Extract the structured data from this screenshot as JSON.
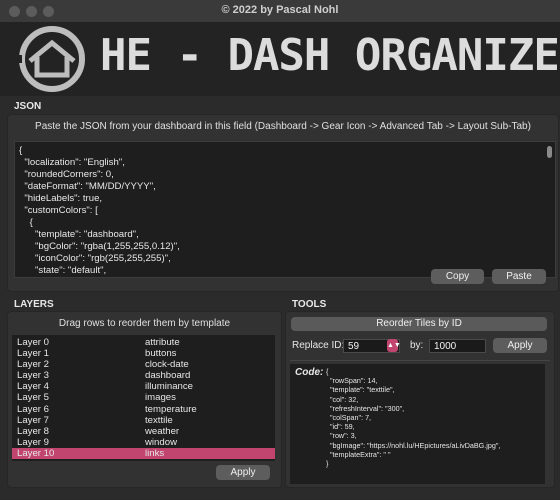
{
  "window": {
    "title": "© 2022 by Pascal Nohl"
  },
  "banner": {
    "title": "HE - DASH ORGANIZER",
    "logo_icon": "house-logo-icon"
  },
  "json_section": {
    "label": "JSON",
    "instructions": "Paste the JSON from your dashboard in this field (Dashboard -> Gear Icon -> Advanced Tab -> Layout Sub-Tab)",
    "lines": [
      "{",
      "  \"localization\": \"English\",",
      "  \"roundedCorners\": 0,",
      "  \"dateFormat\": \"MM/DD/YYYY\",",
      "  \"hideLabels\": true,",
      "  \"customColors\": [",
      "    {",
      "      \"template\": \"dashboard\",",
      "      \"bgColor\": \"rgba(1,255,255,0.12)\",",
      "      \"iconColor\": \"rgb(255,255,255)\",",
      "      \"state\": \"default\","
    ],
    "copy_label": "Copy",
    "paste_label": "Paste"
  },
  "layers_section": {
    "label": "LAYERS",
    "hint": "Drag rows to reorder them by template",
    "rows": [
      {
        "name": "Layer 0",
        "template": "attribute"
      },
      {
        "name": "Layer 1",
        "template": "buttons"
      },
      {
        "name": "Layer 2",
        "template": "clock-date"
      },
      {
        "name": "Layer 3",
        "template": "dashboard"
      },
      {
        "name": "Layer 4",
        "template": "illuminance"
      },
      {
        "name": "Layer 5",
        "template": "images"
      },
      {
        "name": "Layer 6",
        "template": "temperature"
      },
      {
        "name": "Layer 7",
        "template": "texttile"
      },
      {
        "name": "Layer 8",
        "template": "weather"
      },
      {
        "name": "Layer 9",
        "template": "window"
      },
      {
        "name": "Layer 10",
        "template": "links"
      }
    ],
    "selected_index": 10,
    "apply_label": "Apply"
  },
  "tools_section": {
    "label": "TOOLS",
    "reorder_label": "Reorder Tiles by ID",
    "replace_id_label": "Replace ID:",
    "replace_id_value": "59",
    "by_label": "by:",
    "by_value": "1000",
    "apply_label": "Apply",
    "code_label": "Code:",
    "code_lines": [
      "{",
      "  \"rowSpan\": 14,",
      "  \"template\": \"texttile\",",
      "  \"col\": 32,",
      "  \"refreshInterval\": \"300\",",
      "  \"colSpan\": 7,",
      "  \"id\": 59,",
      "  \"row\": 3,",
      "  \"bgImage\": \"https://nohl.lu/HEpictures/aLivDaBG.jpg\",",
      "  \"templateExtra\": \" \"",
      "}"
    ]
  },
  "colors": {
    "accent": "#c2456f",
    "background": "#2b2b2b",
    "panel": "#323232",
    "field": "#1e1e1e"
  }
}
